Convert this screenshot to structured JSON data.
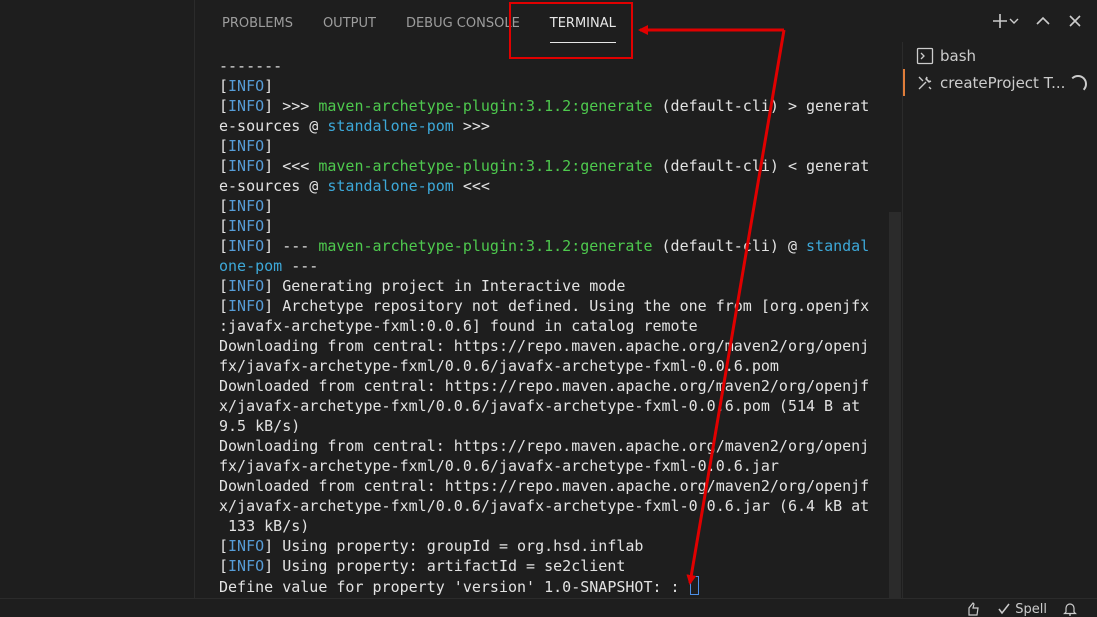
{
  "panel": {
    "tabs": [
      {
        "label": "PROBLEMS"
      },
      {
        "label": "OUTPUT"
      },
      {
        "label": "DEBUG CONSOLE"
      },
      {
        "label": "TERMINAL"
      }
    ],
    "active_tab": "TERMINAL",
    "actions": [
      "plus-icon",
      "chevron-down-icon",
      "chevron-up-icon",
      "close-icon"
    ]
  },
  "terminal_list": {
    "items": [
      {
        "label": "bash",
        "icon": "terminal-icon"
      },
      {
        "label": "createProject  T...",
        "icon": "tools-icon",
        "active": true
      }
    ]
  },
  "terminal": {
    "lines": [
      [
        {
          "t": "-------"
        }
      ],
      [
        {
          "t": "[",
          "c": ""
        },
        {
          "t": "INFO",
          "c": "info"
        },
        {
          "t": "]"
        }
      ],
      [
        {
          "t": "["
        },
        {
          "t": "INFO",
          "c": "info"
        },
        {
          "t": "] >>> "
        },
        {
          "t": "maven-archetype-plugin:3.1.2:generate",
          "c": "green"
        },
        {
          "t": " (default-cli) > generat"
        }
      ],
      [
        {
          "t": "e-sources @ "
        },
        {
          "t": "standalone-pom",
          "c": "cyan"
        },
        {
          "t": " >>>"
        }
      ],
      [
        {
          "t": "["
        },
        {
          "t": "INFO",
          "c": "info"
        },
        {
          "t": "]"
        }
      ],
      [
        {
          "t": "["
        },
        {
          "t": "INFO",
          "c": "info"
        },
        {
          "t": "] <<< "
        },
        {
          "t": "maven-archetype-plugin:3.1.2:generate",
          "c": "green"
        },
        {
          "t": " (default-cli) < generat"
        }
      ],
      [
        {
          "t": "e-sources @ "
        },
        {
          "t": "standalone-pom",
          "c": "cyan"
        },
        {
          "t": " <<<"
        }
      ],
      [
        {
          "t": "["
        },
        {
          "t": "INFO",
          "c": "info"
        },
        {
          "t": "]"
        }
      ],
      [
        {
          "t": "["
        },
        {
          "t": "INFO",
          "c": "info"
        },
        {
          "t": "]"
        }
      ],
      [
        {
          "t": "["
        },
        {
          "t": "INFO",
          "c": "info"
        },
        {
          "t": "] --- "
        },
        {
          "t": "maven-archetype-plugin:3.1.2:generate",
          "c": "green"
        },
        {
          "t": " (default-cli) @ "
        },
        {
          "t": "standal",
          "c": "cyan"
        }
      ],
      [
        {
          "t": "one-pom",
          "c": "cyan"
        },
        {
          "t": " ---"
        }
      ],
      [
        {
          "t": "["
        },
        {
          "t": "INFO",
          "c": "info"
        },
        {
          "t": "] Generating project in Interactive mode"
        }
      ],
      [
        {
          "t": "["
        },
        {
          "t": "INFO",
          "c": "info"
        },
        {
          "t": "] Archetype repository not defined. Using the one from [org.openjfx"
        }
      ],
      [
        {
          "t": ":javafx-archetype-fxml:0.0.6] found in catalog remote"
        }
      ],
      [
        {
          "t": "Downloading from central: https://repo.maven.apache.org/maven2/org/openj"
        }
      ],
      [
        {
          "t": "fx/javafx-archetype-fxml/0.0.6/javafx-archetype-fxml-0.0.6.pom"
        }
      ],
      [
        {
          "t": "Downloaded from central: https://repo.maven.apache.org/maven2/org/openjf"
        }
      ],
      [
        {
          "t": "x/javafx-archetype-fxml/0.0.6/javafx-archetype-fxml-0.0.6.pom (514 B at"
        }
      ],
      [
        {
          "t": "9.5 kB/s)"
        }
      ],
      [
        {
          "t": "Downloading from central: https://repo.maven.apache.org/maven2/org/openj"
        }
      ],
      [
        {
          "t": "fx/javafx-archetype-fxml/0.0.6/javafx-archetype-fxml-0.0.6.jar"
        }
      ],
      [
        {
          "t": "Downloaded from central: https://repo.maven.apache.org/maven2/org/openjf"
        }
      ],
      [
        {
          "t": "x/javafx-archetype-fxml/0.0.6/javafx-archetype-fxml-0.0.6.jar (6.4 kB at"
        }
      ],
      [
        {
          "t": " 133 kB/s)"
        }
      ],
      [
        {
          "t": "["
        },
        {
          "t": "INFO",
          "c": "info"
        },
        {
          "t": "] Using property: groupId = org.hsd.inflab"
        }
      ],
      [
        {
          "t": "["
        },
        {
          "t": "INFO",
          "c": "info"
        },
        {
          "t": "] Using property: artifactId = se2client"
        }
      ],
      [
        {
          "t": "Define value for property 'version' 1.0-SNAPSHOT: : "
        }
      ]
    ],
    "colors": {
      "info": "#569cd6",
      "green": "#4ec94e",
      "cyan": "#3da8d8",
      "text": "#e2e2e2"
    }
  },
  "statusbar": {
    "items": [
      {
        "label": "",
        "icon": "feedback-icon"
      },
      {
        "label": "Spell",
        "icon": "check-icon"
      },
      {
        "label": "",
        "icon": "bell-icon"
      }
    ]
  },
  "annotation": {
    "color": "#e00000"
  }
}
